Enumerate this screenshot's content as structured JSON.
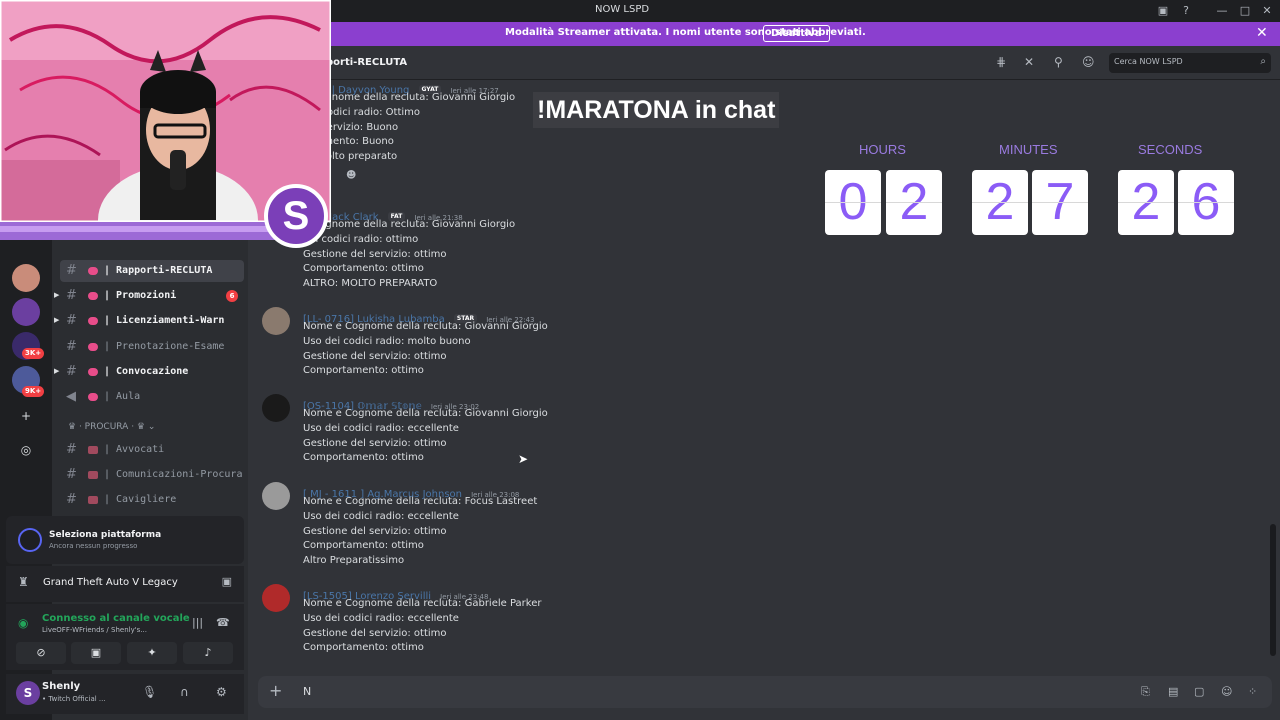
{
  "window": {
    "title": "NOW LSPD"
  },
  "banner": {
    "text": "Modalità Streamer attivata. I nomi utente sono stati abbreviati.",
    "button_label": "Disattiva"
  },
  "rail": {
    "badges": [
      "3K+",
      "9K+"
    ]
  },
  "sidebar": {
    "category": "· PROCURA ·",
    "channels": [
      {
        "name": "| Rapporti-RECLUTA",
        "state": "active"
      },
      {
        "name": "| Promozioni",
        "state": "unread",
        "count": "6"
      },
      {
        "name": "| Licenziamenti-Warn",
        "state": "unread"
      },
      {
        "name": "| Prenotazione-Esame",
        "state": "read"
      },
      {
        "name": "| Convocazione",
        "state": "unread"
      },
      {
        "name": "| Aula",
        "state": "read",
        "type": "voice"
      },
      {
        "name": "| Avvocati",
        "state": "read"
      },
      {
        "name": "| Comunicazioni-Procura",
        "state": "read"
      },
      {
        "name": "| Cavigliere",
        "state": "read"
      }
    ]
  },
  "activity": {
    "title": "Seleziona piattaforma",
    "subtitle": "Ancora nessun progresso"
  },
  "game": {
    "name": "Grand Theft Auto V Legacy"
  },
  "voice": {
    "status": "Connesso al canale vocale",
    "channel": "LiveOFF-WFriends / Shenly's..."
  },
  "user": {
    "name": "Shenly",
    "status": "• Twitch Official ..."
  },
  "channel_header": {
    "name": "porti-RECLUTA",
    "search_placeholder": "Cerca  NOW LSPD"
  },
  "messages": [
    {
      "author": "3814 | Dayvon Young",
      "tag": "GYAT",
      "time": "Ieri alle 17:27",
      "lines": [
        "e Cognome della recluta: Giovanni Giorgio",
        "dei codici radio: Ottimo",
        "del servizio: Buono",
        "ortamento:  Buono",
        "D: Molto preparato"
      ]
    },
    {
      "author": "004] Jack Clark",
      "tag": "FAT",
      "time": "Ieri alle 21:38",
      "lines": [
        "e Cognome della recluta: Giovanni Giorgio",
        "dei codici radio: ottimo",
        "Gestione del servizio: ottimo",
        "Comportamento:  ottimo",
        "ALTRO: MOLTO PREPARATO"
      ]
    },
    {
      "author": "[LL- 0716] Lukisha Lubamba",
      "tag": "STAR",
      "time": "Ieri alle 22:43",
      "lines": [
        "Nome e Cognome della recluta: Giovanni Giorgio",
        "Uso dei codici radio: molto buono",
        "Gestione del servizio: ottimo",
        "Comportamento:  ottimo"
      ]
    },
    {
      "author": "[OS-1104] 𝕆𝕞𝕒𝕣 𝕊𝕥𝕠𝕟𝕖",
      "tag": "",
      "time": "Ieri alle 23:02",
      "lines": [
        "Nome e Cognome della recluta: Giovanni Giorgio",
        "Uso dei codici radio: eccellente",
        "Gestione del servizio: ottimo",
        "Comportamento:  ottimo"
      ]
    },
    {
      "author": "[ MJ - 1611 ] Ag.Marcus Johnson",
      "tag": "",
      "time": "Ieri alle 23:08",
      "lines": [
        "Nome e Cognome della recluta: Focus Lastreet",
        "Uso dei codici radio: eccellente",
        "Gestione del servizio: ottimo",
        "Comportamento:  ottimo",
        "Altro Preparatissimo"
      ]
    },
    {
      "author": "[LS-1505] Lorenzo Servilli",
      "tag": "",
      "time": "Ieri alle 23:48",
      "lines": [
        "Nome e Cognome della recluta: Gabriele Parker",
        "Uso dei codici radio: eccellente",
        "Gestione del servizio: ottimo",
        "Comportamento:  ottimo"
      ]
    }
  ],
  "composer": {
    "value": "N"
  },
  "overlay": {
    "maratona": "!MARATONA in chat",
    "countdown": {
      "labels": [
        "HOURS",
        "MINUTES",
        "SECONDS"
      ],
      "digits": [
        "0",
        "2",
        "2",
        "7",
        "2",
        "6"
      ]
    }
  },
  "colors": {
    "banner": "#8b3fcf",
    "countdown_digit": "#8b5cf6",
    "voice_green": "#23a55a",
    "mention_red": "#f23f43"
  }
}
